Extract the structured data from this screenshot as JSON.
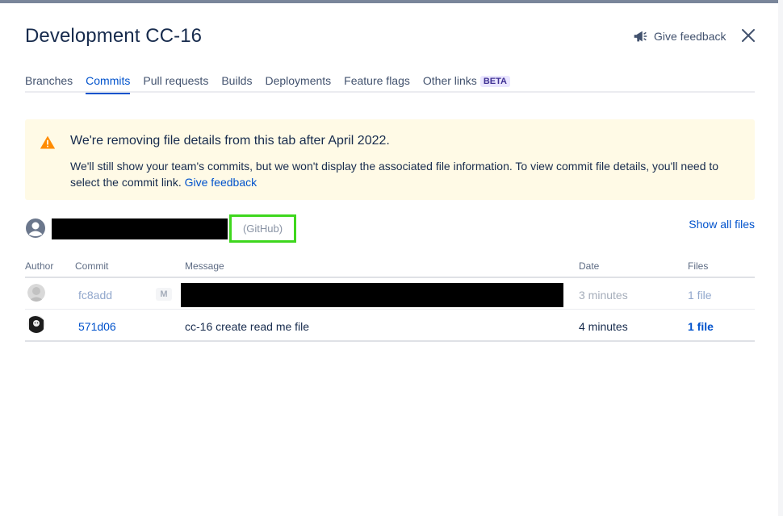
{
  "dialog": {
    "title": "Development CC-16",
    "give_feedback_label": "Give feedback"
  },
  "tabs": [
    {
      "label": "Branches",
      "active": false
    },
    {
      "label": "Commits",
      "active": true
    },
    {
      "label": "Pull requests",
      "active": false
    },
    {
      "label": "Builds",
      "active": false
    },
    {
      "label": "Deployments",
      "active": false
    },
    {
      "label": "Feature flags",
      "active": false
    },
    {
      "label": "Other links",
      "active": false,
      "badge": "BETA"
    }
  ],
  "banner": {
    "title": "We're removing file details from this tab after April 2022.",
    "body": "We'll still show your team's commits, but we won't display the associated file information. To view commit file details, you'll need to select the commit link.",
    "link": "Give feedback",
    "icon": "warning-icon",
    "color": "#fffae6"
  },
  "repository": {
    "provider": "(GitHub)",
    "show_all_files": "Show all files"
  },
  "table": {
    "headers": [
      "Author",
      "Commit",
      "Message",
      "Date",
      "Files"
    ],
    "rows": [
      {
        "commit": "fc8add",
        "badge": "M",
        "message": "",
        "date": "3 minutes",
        "files": "1 file"
      },
      {
        "commit": "571d06",
        "badge": "",
        "message": "cc-16 create read me file",
        "date": "4 minutes",
        "files": "1 file"
      }
    ]
  },
  "colors": {
    "accent": "#0052cc",
    "highlight": "#3ed71d",
    "text": "#172b4d"
  }
}
